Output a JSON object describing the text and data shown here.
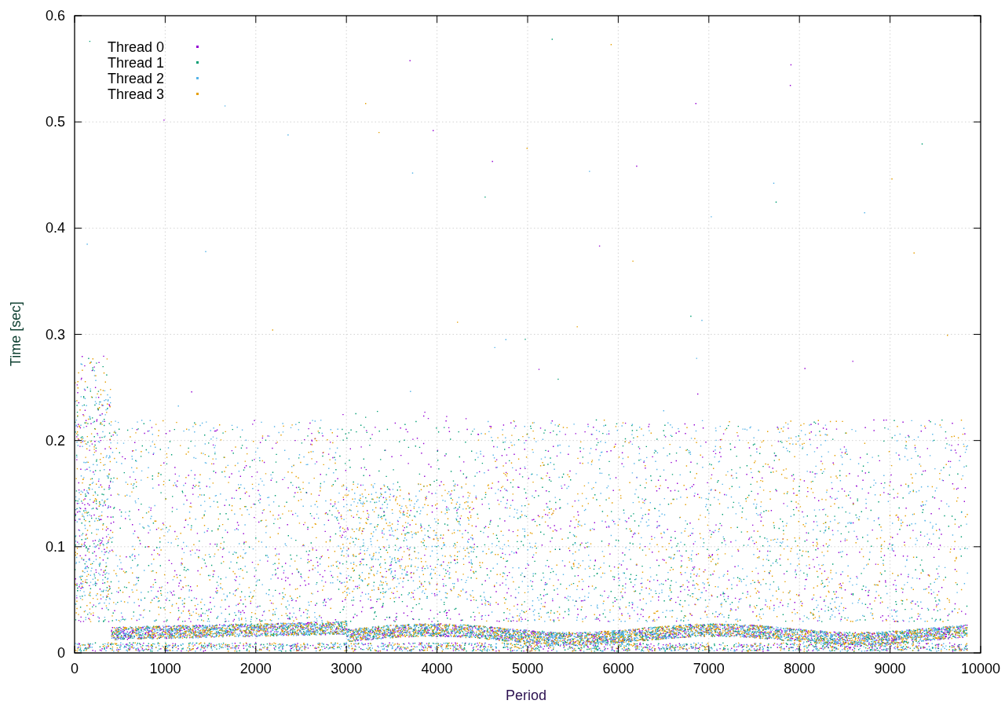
{
  "chart": {
    "xlabel": "Period",
    "ylabel": "Time [sec]",
    "xticks": [
      "0",
      "1000",
      "2000",
      "3000",
      "4000",
      "5000",
      "6000",
      "7000",
      "8000",
      "9000",
      "10000"
    ],
    "yticks": [
      "0.6",
      "0.5",
      "0.4",
      "0.3",
      "0.2",
      "0.1",
      "0"
    ],
    "legend": [
      {
        "name": "Thread 0",
        "color": "#9400d3"
      },
      {
        "name": "Thread 1",
        "color": "#009e73"
      },
      {
        "name": "Thread 2",
        "color": "#56b4e9"
      },
      {
        "name": "Thread 3",
        "color": "#e69f00"
      }
    ]
  }
}
